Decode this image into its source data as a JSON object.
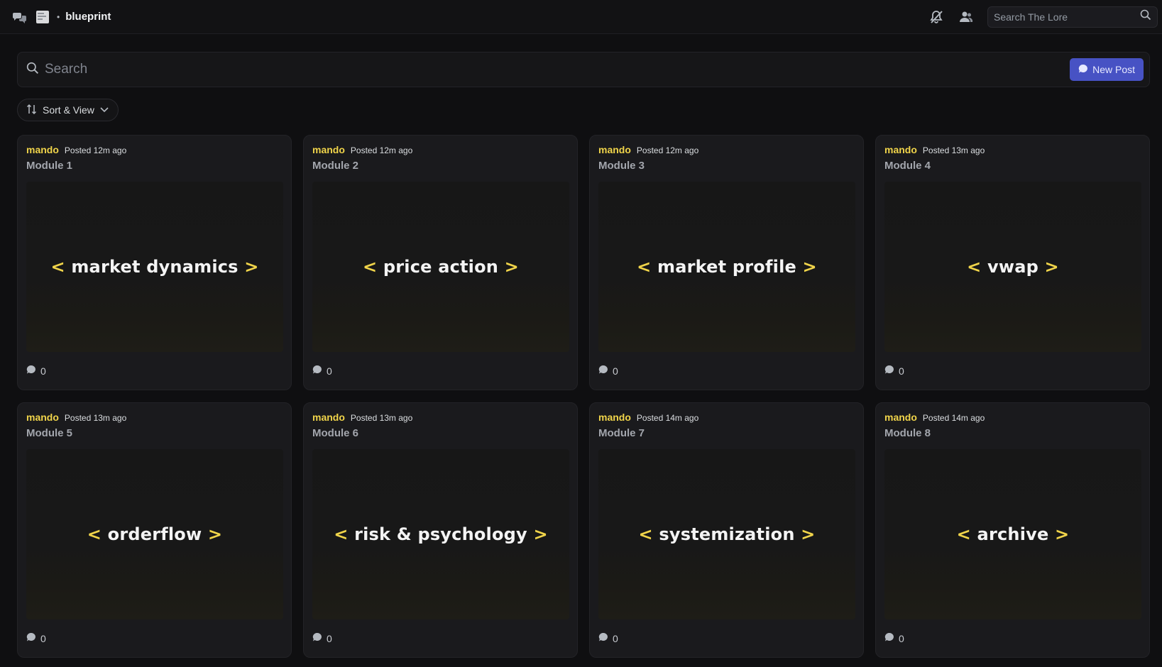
{
  "topbar": {
    "channel_name": "blueprint",
    "separator": "•",
    "lore_search_placeholder": "Search The Lore"
  },
  "forum": {
    "search_placeholder": "Search",
    "new_post_label": "New Post",
    "sort_view_label": "Sort & View"
  },
  "colors": {
    "accent_yellow": "#f0d44a",
    "new_post_bg": "#4752c4"
  },
  "posts": [
    {
      "author": "mando",
      "posted": "Posted 12m ago",
      "title": "Module 1",
      "thumb": "market dynamics",
      "comments": "0"
    },
    {
      "author": "mando",
      "posted": "Posted 12m ago",
      "title": "Module 2",
      "thumb": "price action",
      "comments": "0"
    },
    {
      "author": "mando",
      "posted": "Posted 12m ago",
      "title": "Module 3",
      "thumb": "market profile",
      "comments": "0"
    },
    {
      "author": "mando",
      "posted": "Posted 13m ago",
      "title": "Module 4",
      "thumb": "vwap",
      "comments": "0"
    },
    {
      "author": "mando",
      "posted": "Posted 13m ago",
      "title": "Module 5",
      "thumb": "orderflow",
      "comments": "0"
    },
    {
      "author": "mando",
      "posted": "Posted 13m ago",
      "title": "Module 6",
      "thumb": "risk & psychology",
      "comments": "0"
    },
    {
      "author": "mando",
      "posted": "Posted 14m ago",
      "title": "Module 7",
      "thumb": "systemization",
      "comments": "0"
    },
    {
      "author": "mando",
      "posted": "Posted 14m ago",
      "title": "Module 8",
      "thumb": "archive",
      "comments": "0"
    }
  ]
}
